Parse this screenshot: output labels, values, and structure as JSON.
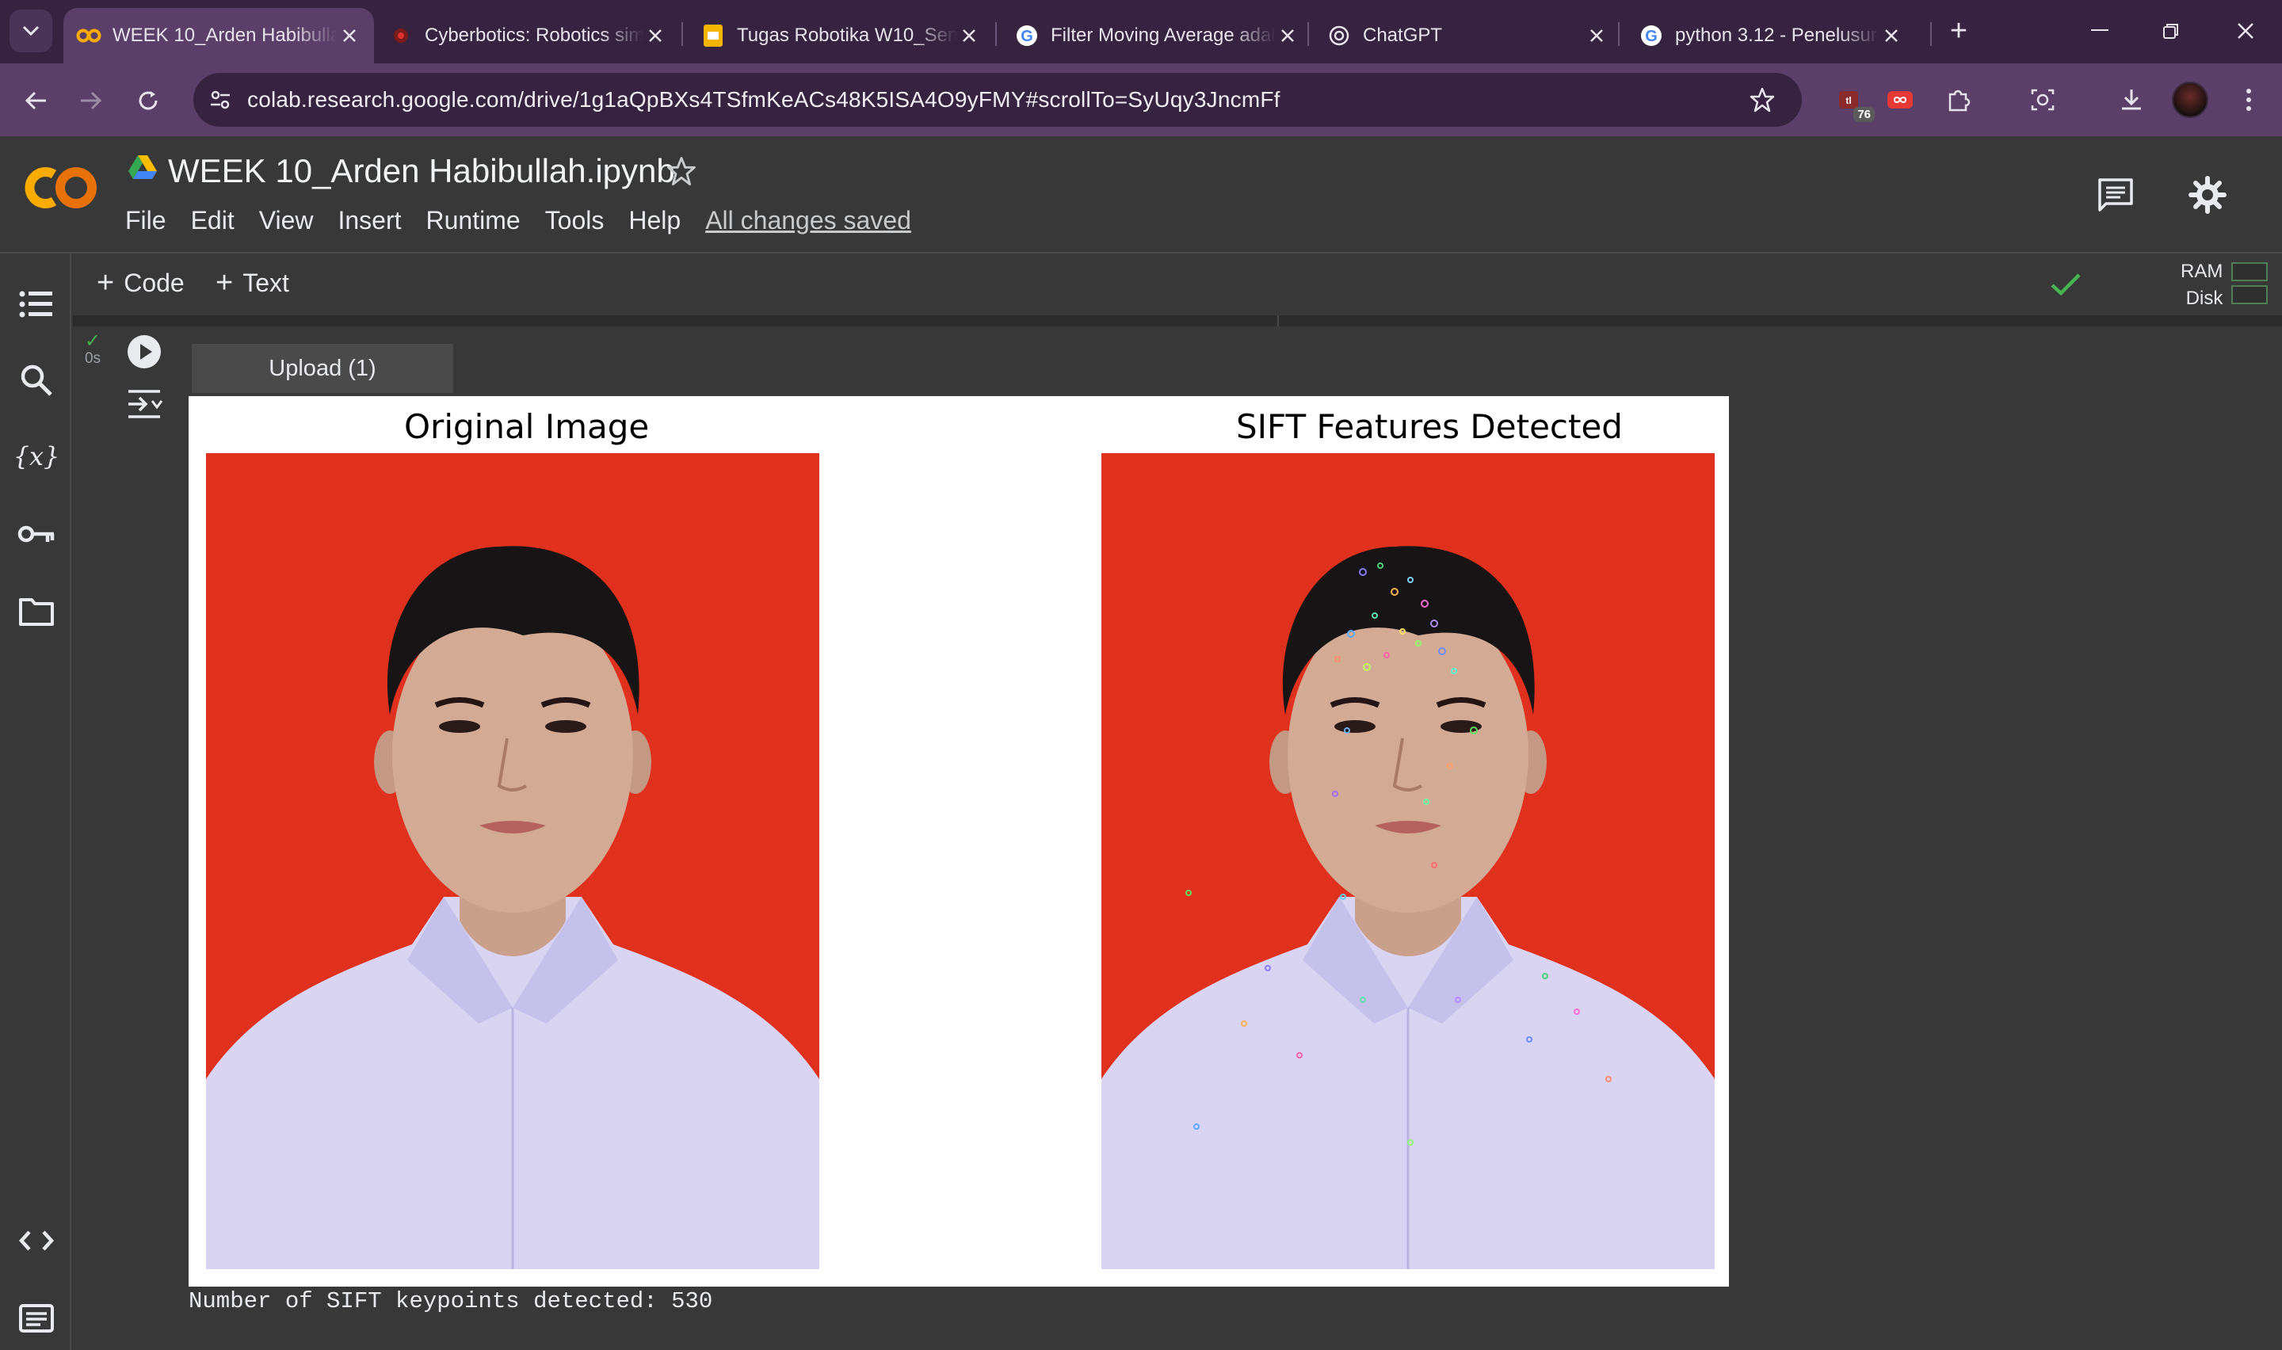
{
  "browser": {
    "tabs": [
      {
        "title": "WEEK 10_Arden Habibullah.ipynb - Colab",
        "favicon": "colab-icon",
        "active": true
      },
      {
        "title": "Cyberbotics: Robotics simulation with Webots",
        "favicon": "webots-icon",
        "active": false
      },
      {
        "title": "Tugas Robotika W10_Sensor",
        "favicon": "slides-icon",
        "active": false
      },
      {
        "title": "Filter Moving Average adalah",
        "favicon": "google-icon",
        "active": false
      },
      {
        "title": "ChatGPT",
        "favicon": "chatgpt-icon",
        "active": false
      },
      {
        "title": "python 3.12 - Penelusuran Google",
        "favicon": "google-icon",
        "active": false
      }
    ],
    "new_tab_label": "+",
    "url": "colab.research.google.com/drive/1g1aQpBXs4TSfmKeACs48K5ISA4O9yFMY#scrollTo=SyUqy3JncmFf",
    "extension_badge": "76"
  },
  "colab": {
    "notebook_title": "WEEK 10_Arden Habibullah.ipynb",
    "menu": [
      "File",
      "Edit",
      "View",
      "Insert",
      "Runtime",
      "Tools",
      "Help"
    ],
    "save_status": "All changes saved",
    "add_code_label": "Code",
    "add_text_label": "Text",
    "ram_label": "RAM",
    "disk_label": "Disk"
  },
  "cell": {
    "exec_time": "0s",
    "upload_label": "Upload (1)",
    "figure": {
      "left_title": "Original Image",
      "right_title": "SIFT Features Detected"
    },
    "stdout": "Number of SIFT keypoints detected: 530"
  },
  "colors": {
    "photo_background": "#e0301e",
    "shirt": "#d8d4f2",
    "colab_orange": "#f9ab00",
    "check_green": "#46b450"
  }
}
